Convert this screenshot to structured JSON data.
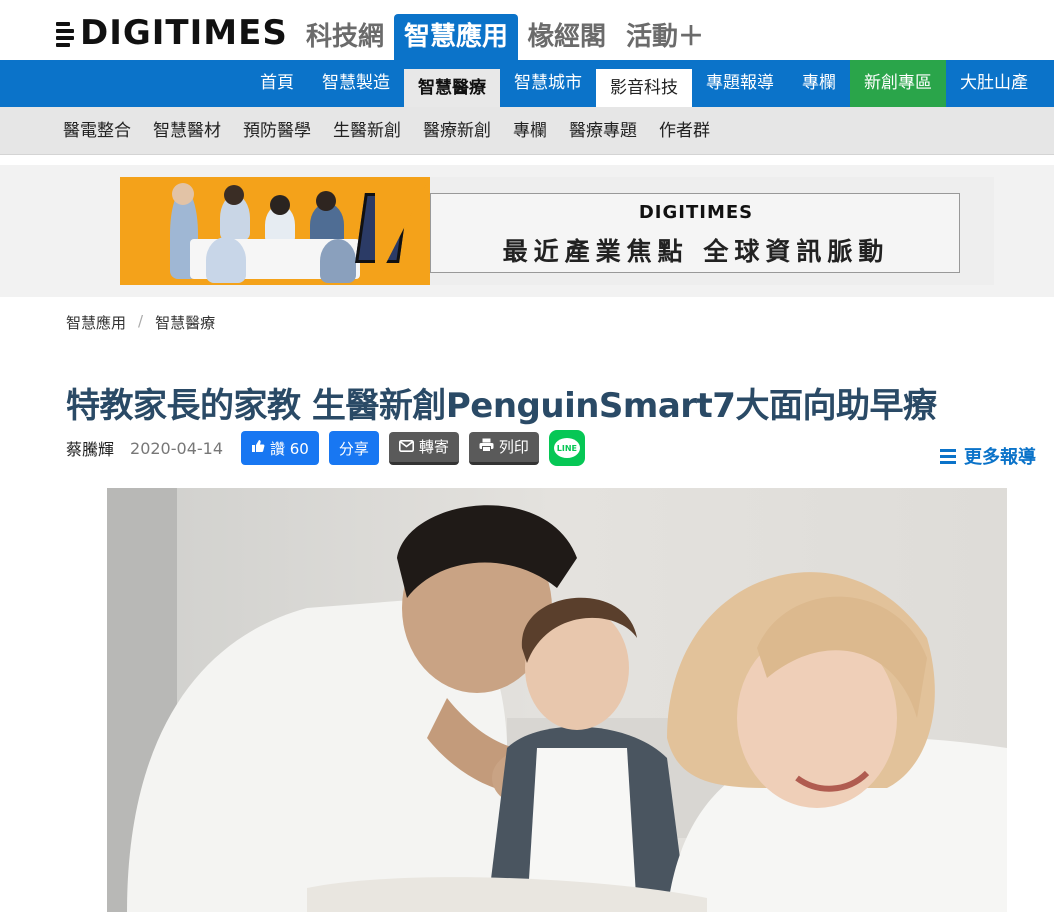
{
  "logo": "DIGITIMES",
  "sections": [
    "科技網",
    "智慧應用",
    "椽經閣",
    "活動＋"
  ],
  "active_section_index": 1,
  "blue_nav": [
    "首頁",
    "智慧製造",
    "智慧醫療",
    "智慧城市",
    "影音科技",
    "專題報導",
    "專欄",
    "新創專區",
    "大肚山產"
  ],
  "gray_nav": [
    "醫電整合",
    "智慧醫材",
    "預防醫學",
    "生醫新創",
    "醫療新創",
    "專欄",
    "醫療專題",
    "作者群"
  ],
  "banner": {
    "logo": "DIGITIMES",
    "slogan": "最近產業焦點 全球資訊脈動"
  },
  "breadcrumb": [
    "智慧應用",
    "智慧醫療"
  ],
  "breadcrumb_sep": "/",
  "article": {
    "title": "特教家長的家教 生醫新創PenguinSmart7大面向助早療",
    "author": "蔡騰輝",
    "date": "2020-04-14",
    "like_label": "讚 60",
    "share_label": "分享",
    "forward_label": "轉寄",
    "print_label": "列印",
    "line_label": "LINE"
  },
  "more_reports": "更多報導",
  "colors": {
    "brand_blue": "#0b73c9",
    "title_color": "#2a4a66",
    "facebook_blue": "#1877f2",
    "line_green": "#06c755",
    "startup_green": "#2aa54a"
  }
}
